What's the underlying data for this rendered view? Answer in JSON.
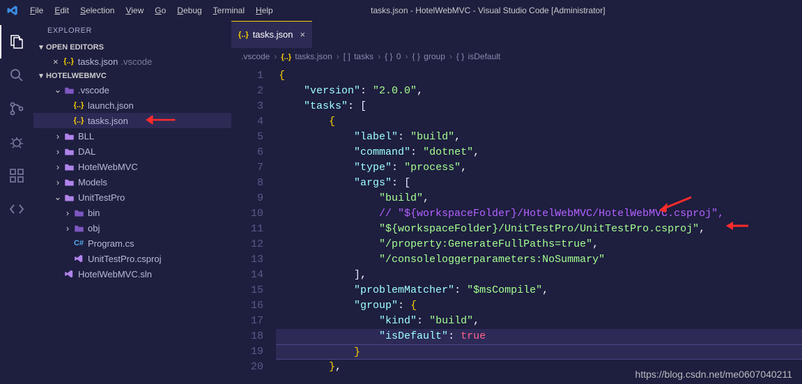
{
  "title": "tasks.json - HotelWebMVC - Visual Studio Code [Administrator]",
  "menu": [
    "File",
    "Edit",
    "Selection",
    "View",
    "Go",
    "Debug",
    "Terminal",
    "Help"
  ],
  "sidebar": {
    "title": "EXPLORER",
    "openEditors": "OPEN EDITORS",
    "openItem": {
      "name": "tasks.json",
      "path": ".vscode"
    },
    "workspace": "HOTELWEBMVC",
    "tree": [
      {
        "type": "folder-open",
        "name": ".vscode",
        "indent": 1,
        "chev": "down",
        "folderClass": "darker"
      },
      {
        "type": "json",
        "name": "launch.json",
        "indent": 2
      },
      {
        "type": "json",
        "name": "tasks.json",
        "indent": 2,
        "selected": true,
        "arrow": true
      },
      {
        "type": "folder",
        "name": "BLL",
        "indent": 1,
        "chev": "right"
      },
      {
        "type": "folder",
        "name": "DAL",
        "indent": 1,
        "chev": "right"
      },
      {
        "type": "folder",
        "name": "HotelWebMVC",
        "indent": 1,
        "chev": "right"
      },
      {
        "type": "folder",
        "name": "Models",
        "indent": 1,
        "chev": "right"
      },
      {
        "type": "folder-open",
        "name": "UnitTestPro",
        "indent": 1,
        "chev": "down"
      },
      {
        "type": "folder",
        "name": "bin",
        "indent": 2,
        "chev": "right",
        "folderClass": "darker"
      },
      {
        "type": "folder",
        "name": "obj",
        "indent": 2,
        "chev": "right",
        "folderClass": "darker"
      },
      {
        "type": "csharp",
        "name": "Program.cs",
        "indent": 2
      },
      {
        "type": "vs",
        "name": "UnitTestPro.csproj",
        "indent": 2
      },
      {
        "type": "vs",
        "name": "HotelWebMVC.sln",
        "indent": 1
      }
    ]
  },
  "tab": {
    "name": "tasks.json"
  },
  "breadcrumb": [
    ".vscode",
    "tasks.json",
    "tasks",
    "0",
    "group",
    "isDefault"
  ],
  "breadcrumbIcons": [
    "",
    "json",
    "array",
    "brace",
    "brace",
    "brace",
    "field"
  ],
  "code": [
    {
      "n": 1,
      "spans": [
        [
          "brace",
          "{"
        ]
      ]
    },
    {
      "n": 2,
      "indent": 4,
      "spans": [
        [
          "key",
          "\"version\""
        ],
        [
          "punct",
          ": "
        ],
        [
          "str",
          "\"2.0.0\""
        ],
        [
          "punct",
          ","
        ]
      ]
    },
    {
      "n": 3,
      "indent": 4,
      "spans": [
        [
          "key",
          "\"tasks\""
        ],
        [
          "punct",
          ": "
        ],
        [
          "bracket",
          "["
        ]
      ]
    },
    {
      "n": 4,
      "indent": 8,
      "spans": [
        [
          "brace inner",
          "{"
        ]
      ]
    },
    {
      "n": 5,
      "indent": 12,
      "spans": [
        [
          "key",
          "\"label\""
        ],
        [
          "punct",
          ": "
        ],
        [
          "str",
          "\"build\""
        ],
        [
          "punct",
          ","
        ]
      ]
    },
    {
      "n": 6,
      "indent": 12,
      "spans": [
        [
          "key",
          "\"command\""
        ],
        [
          "punct",
          ": "
        ],
        [
          "str",
          "\"dotnet\""
        ],
        [
          "punct",
          ","
        ]
      ]
    },
    {
      "n": 7,
      "indent": 12,
      "spans": [
        [
          "key",
          "\"type\""
        ],
        [
          "punct",
          ": "
        ],
        [
          "str",
          "\"process\""
        ],
        [
          "punct",
          ","
        ]
      ]
    },
    {
      "n": 8,
      "indent": 12,
      "spans": [
        [
          "key",
          "\"args\""
        ],
        [
          "punct",
          ": "
        ],
        [
          "bracket",
          "["
        ]
      ]
    },
    {
      "n": 9,
      "indent": 16,
      "spans": [
        [
          "str",
          "\"build\""
        ],
        [
          "punct",
          ","
        ]
      ]
    },
    {
      "n": 10,
      "indent": 16,
      "spans": [
        [
          "com",
          "// \"${workspaceFolder}/HotelWebMVC/HotelWebMVC.csproj\","
        ]
      ],
      "arrowTop": true
    },
    {
      "n": 11,
      "indent": 16,
      "spans": [
        [
          "str",
          "\"${workspaceFolder}/UnitTestPro/UnitTestPro.csproj\""
        ],
        [
          "punct",
          ","
        ]
      ],
      "arrowRight": true
    },
    {
      "n": 12,
      "indent": 16,
      "spans": [
        [
          "str",
          "\"/property:GenerateFullPaths=true\""
        ],
        [
          "punct",
          ","
        ]
      ]
    },
    {
      "n": 13,
      "indent": 16,
      "spans": [
        [
          "str",
          "\"/consoleloggerparameters:NoSummary\""
        ]
      ]
    },
    {
      "n": 14,
      "indent": 12,
      "spans": [
        [
          "bracket",
          "]"
        ],
        [
          "punct",
          ","
        ]
      ]
    },
    {
      "n": 15,
      "indent": 12,
      "spans": [
        [
          "key",
          "\"problemMatcher\""
        ],
        [
          "punct",
          ": "
        ],
        [
          "str",
          "\"$msCompile\""
        ],
        [
          "punct",
          ","
        ]
      ]
    },
    {
      "n": 16,
      "indent": 12,
      "spans": [
        [
          "key",
          "\"group\""
        ],
        [
          "punct",
          ": "
        ],
        [
          "brace inner",
          "{"
        ]
      ]
    },
    {
      "n": 17,
      "indent": 16,
      "spans": [
        [
          "key",
          "\"kind\""
        ],
        [
          "punct",
          ": "
        ],
        [
          "str",
          "\"build\""
        ],
        [
          "punct",
          ","
        ]
      ]
    },
    {
      "n": 18,
      "indent": 16,
      "spans": [
        [
          "key",
          "\"isDefault\""
        ],
        [
          "punct",
          ": "
        ],
        [
          "bool",
          "true"
        ]
      ],
      "highlight": true
    },
    {
      "n": 19,
      "indent": 12,
      "spans": [
        [
          "brace inner",
          "}"
        ]
      ],
      "selected": true
    },
    {
      "n": 20,
      "indent": 8,
      "spans": [
        [
          "brace inner",
          "}"
        ],
        [
          "punct",
          ","
        ]
      ]
    }
  ],
  "watermark": "https://blog.csdn.net/me0607040211"
}
